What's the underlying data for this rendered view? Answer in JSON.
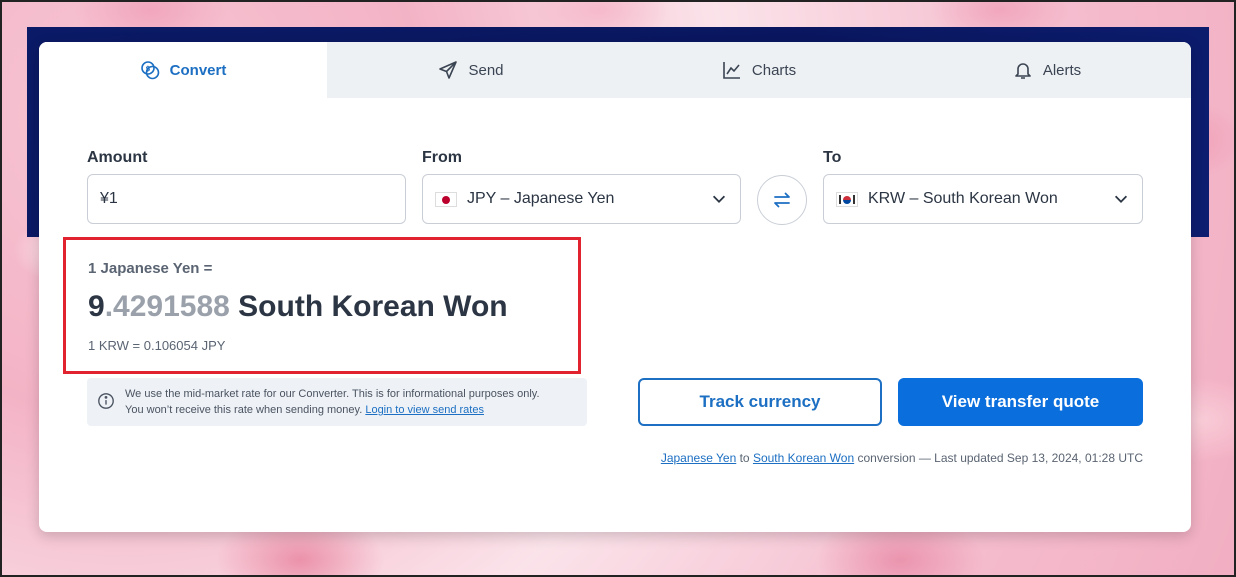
{
  "tabs": [
    {
      "label": "Convert",
      "icon": "coins-icon",
      "active": true
    },
    {
      "label": "Send",
      "icon": "paper-plane-icon"
    },
    {
      "label": "Charts",
      "icon": "line-chart-icon"
    },
    {
      "label": "Alerts",
      "icon": "bell-icon"
    }
  ],
  "amount": {
    "label": "Amount",
    "value": "¥1"
  },
  "from": {
    "label": "From",
    "value": "JPY – Japanese Yen",
    "flag": "JP"
  },
  "to": {
    "label": "To",
    "value": "KRW – South Korean Won",
    "flag": "KR"
  },
  "result": {
    "from_text": "1 Japanese Yen =",
    "main_int": "9",
    "main_dec": ".4291588",
    "main_unit": " South Korean Won",
    "inverse": "1 KRW = 0.106054 JPY"
  },
  "info": {
    "line1": "We use the mid-market rate for our Converter. This is for informational purposes only.",
    "line2": "You won’t receive this rate when sending money.",
    "link": "Login to view send rates"
  },
  "buttons": {
    "track": "Track currency",
    "quote": "View transfer quote"
  },
  "footer": {
    "from_link": "Japanese Yen",
    "to_word": "to",
    "to_link": "South Korean Won",
    "rest": "conversion — Last updated Sep 13, 2024, 01:28 UTC"
  },
  "colors": {
    "accent": "#1c6fc2",
    "primary_button": "#0a6edc",
    "highlight_border": "#e0232e"
  }
}
